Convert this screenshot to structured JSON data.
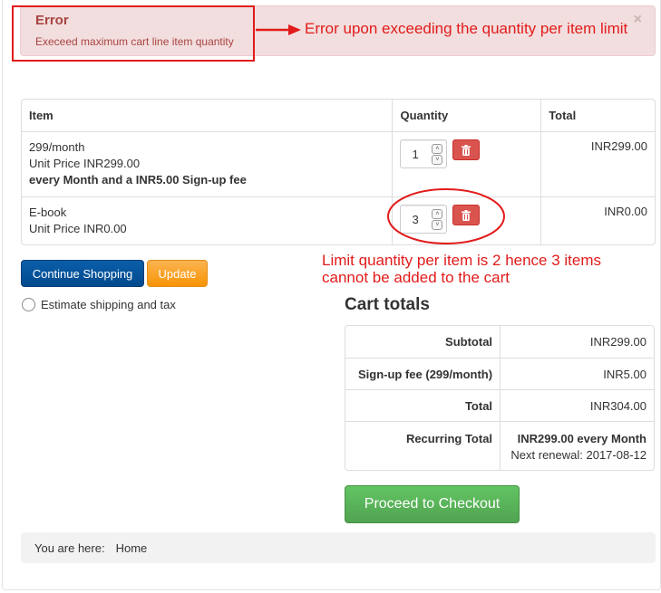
{
  "alert": {
    "title": "Error",
    "message": "Execeed maximum cart line item quantity",
    "close_glyph": "×",
    "color": "#a94442",
    "background": "#f2dede"
  },
  "annotations": {
    "error_note": "Error upon exceeding the quantity per item limit",
    "limit_note_line1": "Limit quantity per item is 2 hence 3 items",
    "limit_note_line2": "cannot be added to the cart",
    "color": "#e21b1b"
  },
  "cart": {
    "headers": {
      "item": "Item",
      "quantity": "Quantity",
      "total": "Total"
    },
    "rows": [
      {
        "name": "299/month",
        "unit_price": "Unit Price INR299.00",
        "note": "every Month and a INR5.00 Sign-up fee",
        "quantity": "1",
        "total": "INR299.00"
      },
      {
        "name": "E-book",
        "unit_price": "Unit Price INR0.00",
        "quantity": "3",
        "total": "INR0.00"
      }
    ],
    "spin_up": "˄",
    "spin_down": "˅",
    "delete_icon": "trash-icon"
  },
  "buttons": {
    "continue_shopping": "Continue Shopping",
    "update": "Update",
    "proceed_checkout": "Proceed to Checkout"
  },
  "estimate": {
    "label": "Estimate shipping and tax"
  },
  "totals": {
    "heading": "Cart totals",
    "rows": [
      {
        "label": "Subtotal",
        "value": "INR299.00"
      },
      {
        "label": "Sign-up fee (299/month)",
        "value": "INR5.00"
      },
      {
        "label": "Total",
        "value": "INR304.00"
      }
    ],
    "recurring": {
      "label": "Recurring Total",
      "value": "INR299.00 every Month",
      "renewal": "Next renewal: 2017-08-12"
    }
  },
  "breadcrumb": {
    "prefix": "You are here:",
    "home": "Home"
  },
  "colors": {
    "primary_button": "#0b5eaa",
    "update_button": "#f89406",
    "checkout_button": "#5cb85c",
    "delete_button": "#d9534f"
  }
}
